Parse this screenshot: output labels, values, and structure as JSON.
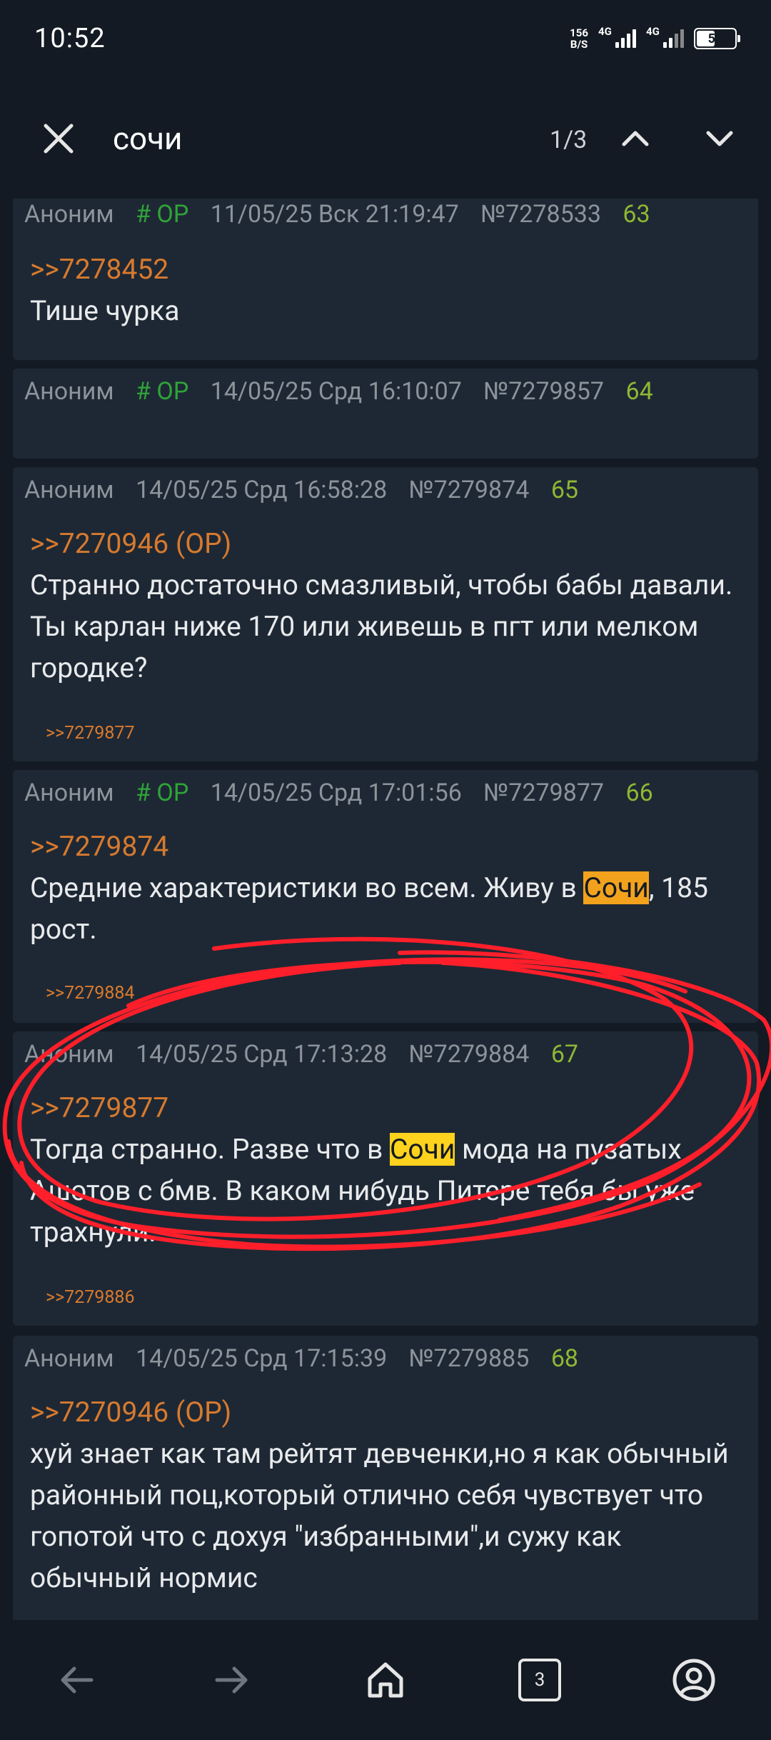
{
  "status_bar": {
    "time": "10:52",
    "net_speed_value": "156",
    "net_speed_unit": "B/S",
    "sim1_label": "4G",
    "sim2_label": "4G",
    "battery": "53",
    "battery_level": 0.53
  },
  "find_bar": {
    "query": "сочи",
    "match_counter": "1/3",
    "close_icon": "close-icon",
    "prev_icon": "chevron-up-icon",
    "next_icon": "chevron-down-icon"
  },
  "posts": [
    {
      "author": "Аноним",
      "op_tag": "# OP",
      "datetime": "11/05/25 Вск 21:19:47",
      "post_id": "№7278533",
      "index": "63",
      "reply_to": ">>7278452",
      "text": "Тише чурка"
    },
    {
      "author": "Аноним",
      "op_tag": "# OP",
      "datetime": "14/05/25 Срд 16:10:07",
      "post_id": "№7279857",
      "index": "64"
    },
    {
      "author": "Аноним",
      "datetime": "14/05/25 Срд 16:58:28",
      "post_id": "№7279874",
      "index": "65",
      "reply_to": ">>7270946 (OP)",
      "text": "Странно достаточно смазливый, чтобы бабы давали. Ты карлан ниже 170 или живешь в пгт или мелком городке?",
      "backlink": ">>7279877"
    },
    {
      "author": "Аноним",
      "op_tag": "# OP",
      "datetime": "14/05/25 Срд 17:01:56",
      "post_id": "№7279877",
      "index": "66",
      "reply_to": ">>7279874",
      "text_before": "Средние характеристики во всем. Живу в ",
      "text_match": "Сочи",
      "text_after": ", 185 рост.",
      "backlink": ">>7279884"
    },
    {
      "author": "Аноним",
      "datetime": "14/05/25 Срд 17:13:28",
      "post_id": "№7279884",
      "index": "67",
      "reply_to": ">>7279877",
      "text_before": "Тогда странно. Разве что в ",
      "text_match": "Сочи",
      "text_after": " мода на пузатых Ашотов с бмв. В каком нибудь Питере тебя бы уже трахнули.",
      "backlink": ">>7279886"
    },
    {
      "author": "Аноним",
      "datetime": "14/05/25 Срд 17:15:39",
      "post_id": "№7279885",
      "index": "68",
      "reply_to": ">>7270946 (OP)",
      "text": "хуй знает как там рейтят девченки,но я как обычный районный поц,который отлично себя чувствует что гопотой что с дохуя \"избранными\",и сужу как обычный нормис"
    }
  ],
  "bottom_nav": {
    "back_icon": "arrow-left-icon",
    "forward_icon": "arrow-right-icon",
    "home_icon": "home-icon",
    "tab_count": "3",
    "account_icon": "account-icon"
  },
  "colors": {
    "background": "#131a23",
    "post_background": "#1e2834",
    "reply_link": "#d77a2e",
    "op_tag": "#2fa33a",
    "post_index": "#8fb833",
    "highlight": "#ffd21e",
    "annotation": "#ff1f2a"
  }
}
